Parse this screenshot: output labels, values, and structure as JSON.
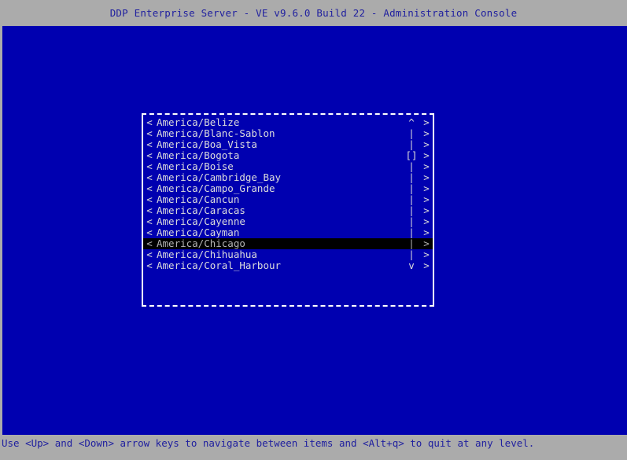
{
  "window": {
    "title": "DDP Enterprise Server - VE v9.6.0 Build 22 - Administration Console",
    "background_color": "#0000b0",
    "chrome_color": "#ababab",
    "chrome_text_color": "#20209f",
    "text_color": "#dcdcdc",
    "selection_bg_color": "#000000",
    "selection_text_color": "#b4b4b4"
  },
  "dialog": {
    "name": "timezone-selection-list",
    "left_marker": "<",
    "right_marker": ">",
    "scroll": {
      "up_arrow": "^",
      "down_arrow": "v",
      "track": "|",
      "thumb": "[]",
      "thumb_row_index": 3
    },
    "selected_index": 11,
    "items": [
      {
        "label": "America/Belize",
        "scroll_glyph": "^"
      },
      {
        "label": "America/Blanc-Sablon",
        "scroll_glyph": "|"
      },
      {
        "label": "America/Boa_Vista",
        "scroll_glyph": "|"
      },
      {
        "label": "America/Bogota",
        "scroll_glyph": "[]"
      },
      {
        "label": "America/Boise",
        "scroll_glyph": "|"
      },
      {
        "label": "America/Cambridge_Bay",
        "scroll_glyph": "|"
      },
      {
        "label": "America/Campo_Grande",
        "scroll_glyph": "|"
      },
      {
        "label": "America/Cancun",
        "scroll_glyph": "|"
      },
      {
        "label": "America/Caracas",
        "scroll_glyph": "|"
      },
      {
        "label": "America/Cayenne",
        "scroll_glyph": "|"
      },
      {
        "label": "America/Cayman",
        "scroll_glyph": "|"
      },
      {
        "label": "America/Chicago",
        "scroll_glyph": "|"
      },
      {
        "label": "America/Chihuahua",
        "scroll_glyph": "|"
      },
      {
        "label": "America/Coral_Harbour",
        "scroll_glyph": "v"
      }
    ]
  },
  "statusbar": {
    "hint": "Use <Up> and <Down> arrow keys to navigate between items and <Alt+q> to quit at any level."
  }
}
